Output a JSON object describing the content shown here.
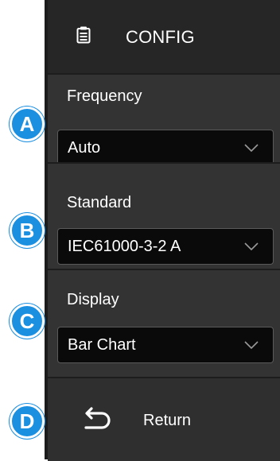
{
  "header": {
    "title": "CONFIG",
    "icon": "config-list-icon"
  },
  "frequency": {
    "label": "Frequency",
    "value": "Auto"
  },
  "standard": {
    "label": "Standard",
    "value": "IEC61000-3-2 A"
  },
  "display": {
    "label": "Display",
    "value": "Bar Chart"
  },
  "return": {
    "label": "Return",
    "icon": "return-arrow-icon"
  },
  "badges": {
    "a": "A",
    "b": "B",
    "c": "C",
    "d": "D"
  },
  "colors": {
    "badge": "#1b8fe0",
    "panel": "#2b2b2b",
    "select_bg": "#0a0a0a"
  }
}
